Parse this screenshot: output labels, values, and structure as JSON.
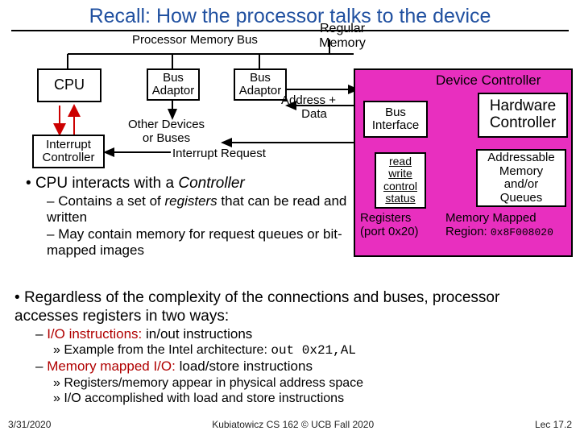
{
  "title": "Recall: How the processor talks to the device",
  "labels": {
    "pmbus": "Processor Memory Bus",
    "regmem_l1": "Regular",
    "regmem_l2": "Memory",
    "cpu": "CPU",
    "busadaptor_l1": "Bus",
    "busadaptor_l2": "Adaptor",
    "other_l1": "Other Devices",
    "other_l2": "or Buses",
    "interrupt_l1": "Interrupt",
    "interrupt_l2": "Controller",
    "irq": "Interrupt Request",
    "addrdata_l1": "Address +",
    "addrdata_l2": "Data"
  },
  "device": {
    "title": "Device Controller",
    "busif_l1": "Bus",
    "busif_l2": "Interface",
    "hwc_l1": "Hardware",
    "hwc_l2": "Controller",
    "reg_read": "read",
    "reg_write": "write",
    "reg_control": "control",
    "reg_status": "status",
    "regs_l1": "Registers",
    "regs_l2": "(port 0x20)",
    "mem_l1": "Addressable",
    "mem_l2": "Memory",
    "mem_l3": "and/or",
    "mem_l4": "Queues",
    "mm_l1": "Memory Mapped",
    "mm_l2_a": "Region: ",
    "mm_l2_b": "0x8F008020"
  },
  "bullets": {
    "b1a_a": "CPU interacts with a ",
    "b1a_b": "Controller",
    "b1a_s1_a": "Contains a set of ",
    "b1a_s1_b": "registers",
    "b1a_s1_c": " that can be read and written",
    "b1a_s2": "May contain memory for request queues or bit-mapped images",
    "b1b": "Regardless of the complexity of the connections and buses, processor accesses registers in two ways:",
    "b1b_s1_a": "I/O instructions:",
    "b1b_s1_b": " in/out instructions",
    "b1b_s1_ex_a": "Example from the Intel architecture: ",
    "b1b_s1_ex_b": "out 0x21,AL",
    "b1b_s2_a": "Memory mapped I/O:",
    "b1b_s2_b": " load/store instructions",
    "b1b_s2_ex1": "Registers/memory appear in physical address space",
    "b1b_s2_ex2": "I/O accomplished with load and store instructions"
  },
  "footer": {
    "left": "3/31/2020",
    "center": "Kubiatowicz CS 162 © UCB Fall 2020",
    "right": "Lec 17.2"
  }
}
